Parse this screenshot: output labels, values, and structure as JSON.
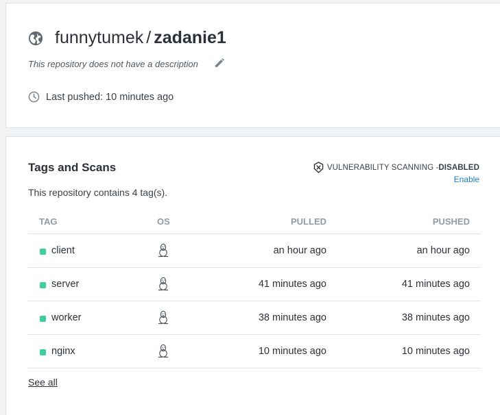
{
  "repo": {
    "namespace": "funnytumek",
    "separator": "/",
    "name": "zadanie1",
    "description": "This repository does not have a description",
    "last_pushed": "Last pushed: 10 minutes ago"
  },
  "tags_section": {
    "title": "Tags and Scans",
    "count_text": "This repository contains 4 tag(s).",
    "vuln_label": "VULNERABILITY SCANNING - ",
    "vuln_status": "DISABLED",
    "enable_label": "Enable",
    "columns": [
      "TAG",
      "OS",
      "PULLED",
      "PUSHED"
    ],
    "rows": [
      {
        "tag": "client",
        "os_icon": "linux-icon",
        "pulled": "an hour ago",
        "pushed": "an hour ago"
      },
      {
        "tag": "server",
        "os_icon": "linux-icon",
        "pulled": "41 minutes ago",
        "pushed": "41 minutes ago"
      },
      {
        "tag": "worker",
        "os_icon": "linux-icon",
        "pulled": "38 minutes ago",
        "pushed": "38 minutes ago"
      },
      {
        "tag": "nginx",
        "os_icon": "linux-icon",
        "pulled": "10 minutes ago",
        "pushed": "10 minutes ago"
      }
    ],
    "see_all": "See all"
  },
  "colors": {
    "tag_dot": "#3fcf9f",
    "link": "#1f7bc1",
    "header_text": "#8f9ba6"
  }
}
